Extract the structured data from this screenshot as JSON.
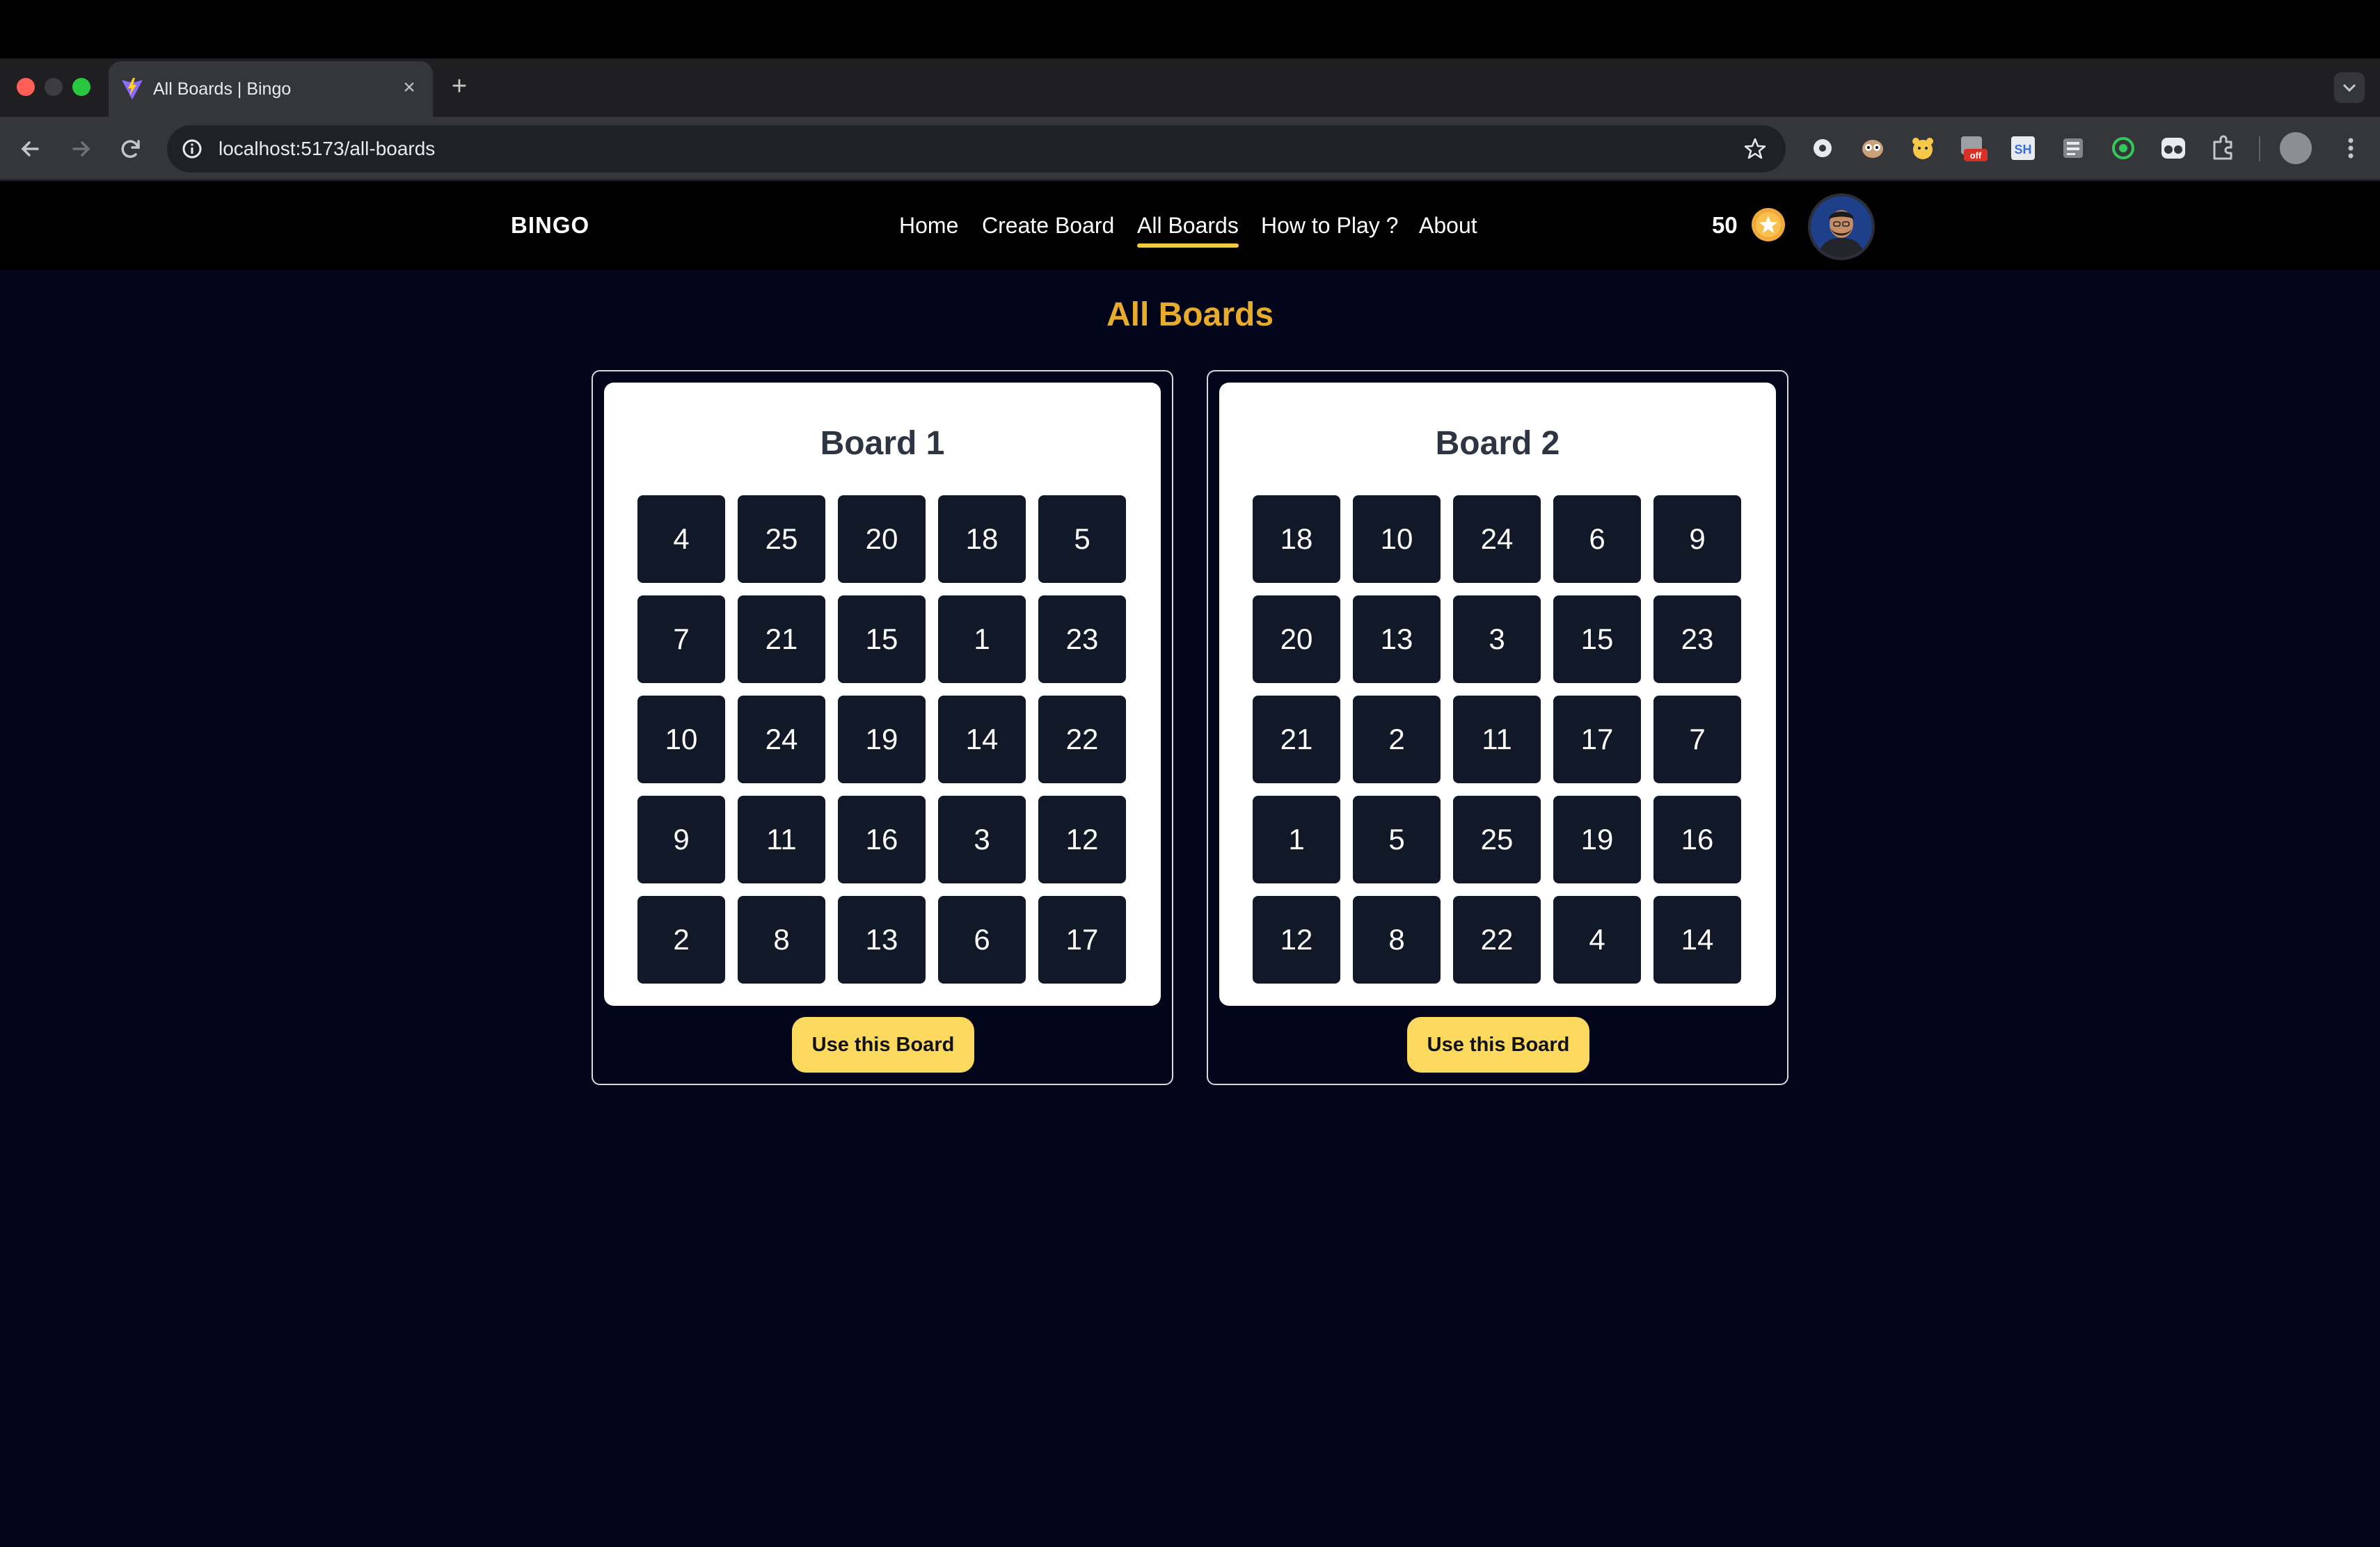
{
  "browser": {
    "tab_title": "All Boards | Bingo",
    "new_tab_label": "+",
    "url": "localhost:5173/all-boards",
    "extension_icons": [
      "ext-circle-icon",
      "ext-owl-icon",
      "ext-bear-icon",
      "ext-off-icon",
      "ext-sh-icon",
      "ext-print-icon",
      "ext-target-icon",
      "ext-glasses-icon",
      "extensions-puzzle-icon"
    ]
  },
  "header": {
    "brand": "BINGO",
    "nav": [
      "Home",
      "Create Board",
      "All Boards",
      "How to Play ?",
      "About"
    ],
    "active_nav": "All Boards",
    "coins": "50",
    "coin_color": "#f2a93b"
  },
  "main": {
    "title": "All Boards",
    "title_color": "#e8ac2c",
    "boards": [
      {
        "name": "Board 1",
        "numbers": [
          4,
          25,
          20,
          18,
          5,
          7,
          21,
          15,
          1,
          23,
          10,
          24,
          19,
          14,
          22,
          9,
          11,
          16,
          3,
          12,
          2,
          8,
          13,
          6,
          17
        ],
        "button_label": "Use this Board"
      },
      {
        "name": "Board 2",
        "numbers": [
          18,
          10,
          24,
          6,
          9,
          20,
          13,
          3,
          15,
          23,
          21,
          2,
          11,
          17,
          7,
          1,
          5,
          25,
          19,
          16,
          12,
          8,
          22,
          4,
          14
        ],
        "button_label": "Use this Board"
      }
    ]
  }
}
